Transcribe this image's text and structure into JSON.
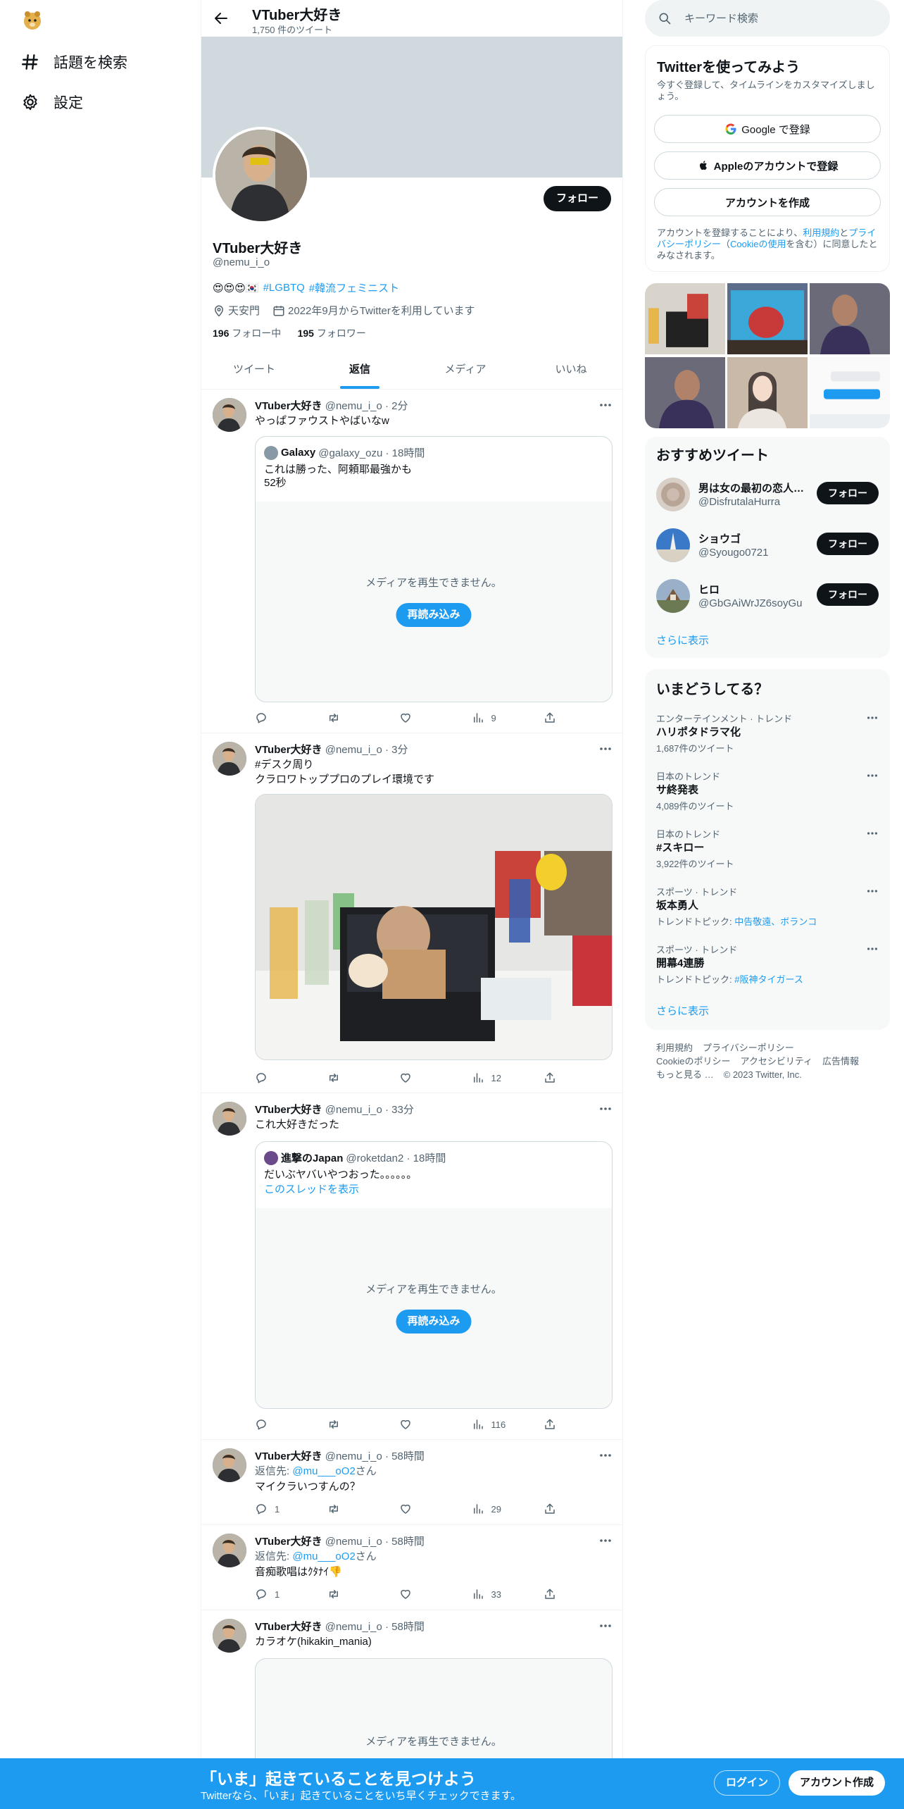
{
  "nav": {
    "explore_label": "話題を検索",
    "settings_label": "設定"
  },
  "header": {
    "name": "VTuber大好き",
    "tweet_count": "1,750 件のツイート"
  },
  "profile": {
    "name": "VTuber大好き",
    "handle": "@nemu_i_o",
    "follow_label": "フォロー",
    "bio_emoji": "😍😍😍🇰🇷",
    "bio_tag1": "#LGBTQ",
    "bio_tag2": "#韓流フェミニスト",
    "location": "天安門",
    "joined": "2022年9月からTwitterを利用しています",
    "following_count": "196",
    "following_label": "フォロー中",
    "followers_count": "195",
    "followers_label": "フォロワー"
  },
  "tabs": [
    {
      "label": "ツイート"
    },
    {
      "label": "返信"
    },
    {
      "label": "メディア"
    },
    {
      "label": "いいね"
    }
  ],
  "tweets": [
    {
      "name": "VTuber大好き",
      "meta": "@nemu_i_o · 2分",
      "text": "やっぱファウストやばいなw",
      "quote": {
        "name": "Galaxy",
        "meta": "@galaxy_ozu · 18時間",
        "line1": "これは勝った、阿頼耶最強かも",
        "line2": "52秒"
      },
      "media_error": "メディアを再生できません。",
      "reload": "再読み込み",
      "views": "9"
    },
    {
      "name": "VTuber大好き",
      "meta": "@nemu_i_o · 3分",
      "hashtag": "#デスク周り",
      "text": "クラロワトッププロのプレイ環境です",
      "views": "12"
    },
    {
      "name": "VTuber大好き",
      "meta": "@nemu_i_o · 33分",
      "text": "これ大好きだった",
      "quote": {
        "name": "進撃のJapan",
        "meta": "@roketdan2 · 18時間",
        "line1": "だいぶヤバいやつおった。。。。。。",
        "thread": "このスレッドを表示"
      },
      "media_error": "メディアを再生できません。",
      "reload": "再読み込み",
      "views": "116"
    },
    {
      "name": "VTuber大好き",
      "meta": "@nemu_i_o · 58時間",
      "reply_prefix": "返信先: ",
      "reply_to": "@mu___oO2",
      "reply_suffix": "さん",
      "text": "マイクラいつすんの？",
      "replies": "1",
      "views": "29"
    },
    {
      "name": "VTuber大好き",
      "meta": "@nemu_i_o · 58時間",
      "reply_prefix": "返信先: ",
      "reply_to": "@mu___oO2",
      "reply_suffix": "さん",
      "text": "音痴歌唱はｸﾀﾅｲ👎",
      "replies": "1",
      "views": "33"
    },
    {
      "name": "VTuber大好き",
      "meta": "@nemu_i_o · 58時間",
      "text": "カラオケ(hikakin_mania)",
      "media_error": "メディアを再生できません。"
    }
  ],
  "search": {
    "placeholder": "キーワード検索"
  },
  "signup": {
    "title": "Twitterを使ってみよう",
    "subtitle": "今すぐ登録して、タイムラインをカスタマイズしましょう。",
    "google_label": "Google で登録",
    "apple_label": "Appleのアカウントで登録",
    "create_label": "アカウントを作成",
    "terms_1": "アカウントを登録することにより、",
    "terms_link1": "利用規約",
    "terms_2": "と",
    "terms_link2": "プライバシーポリシー",
    "terms_3": "（",
    "terms_link3": "Cookieの使用",
    "terms_4": "を含む）に同意したとみなされます。"
  },
  "who_to_follow": {
    "title": "おすすめツイート",
    "users": [
      {
        "name": "男は女の最初の恋人…",
        "handle": "@DisfrutalaHurra",
        "follow": "フォロー"
      },
      {
        "name": "ショウゴ",
        "handle": "@Syougo0721",
        "follow": "フォロー"
      },
      {
        "name": "ヒロ",
        "handle": "@GbGAiWrJZ6soyGu",
        "follow": "フォロー"
      }
    ],
    "show_more": "さらに表示"
  },
  "trends": {
    "title": "いまどうしてる？",
    "items": [
      {
        "category": "エンターテインメント · トレンド",
        "name": "ハリポタドラマ化",
        "count": "1,687件のツイート"
      },
      {
        "category": "日本のトレンド",
        "name": "サ終発表",
        "count": "4,089件のツイート"
      },
      {
        "category": "日本のトレンド",
        "name": "#スキロー",
        "count": "3,922件のツイート"
      },
      {
        "category": "スポーツ · トレンド",
        "name": "坂本勇人",
        "topic_prefix": "トレンドトピック: ",
        "topic": "中告敬遠、ボランコ"
      },
      {
        "category": "スポーツ · トレンド",
        "name": "開幕4連勝",
        "topic_prefix": "トレンドトピック: ",
        "topic": "#阪神タイガース"
      }
    ],
    "show_more": "さらに表示"
  },
  "footer": {
    "links": [
      "利用規約",
      "プライバシーポリシー",
      "Cookieのポリシー",
      "アクセシビリティ",
      "広告情報",
      "もっと見る …"
    ],
    "copyright": "© 2023 Twitter, Inc."
  },
  "bottom_bar": {
    "title": "「いま」起きていることを見つけよう",
    "subtitle": "Twitterなら、「いま」起きていることをいち早くチェックできます。",
    "login": "ログイン",
    "signup": "アカウント作成"
  },
  "colors": {
    "accent": "#1d9bf0",
    "text": "#0f1419",
    "muted": "#536471",
    "banner": "#cfd9de"
  }
}
